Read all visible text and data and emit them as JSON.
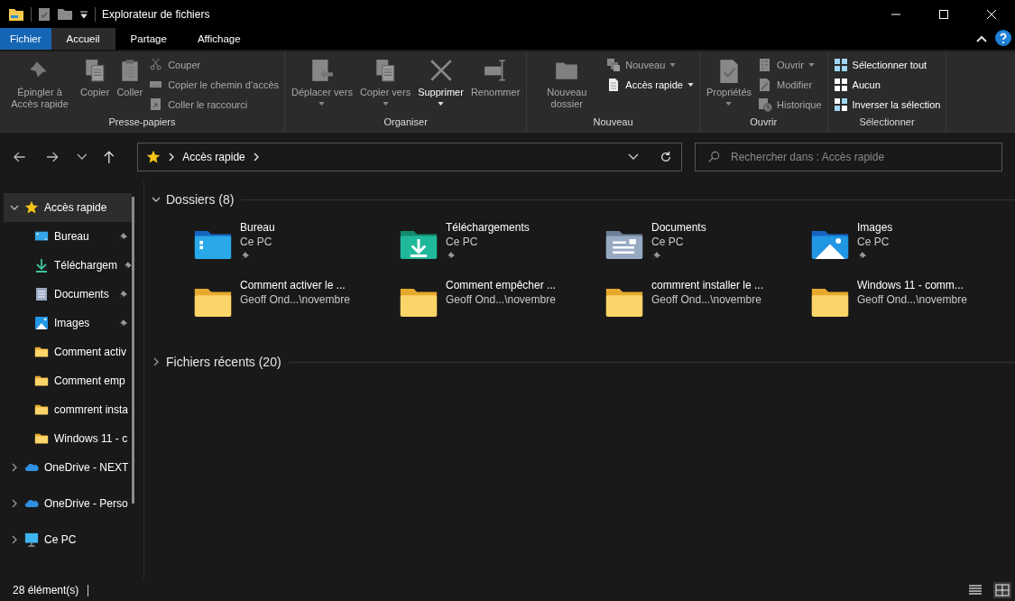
{
  "window": {
    "title": "Explorateur de fichiers"
  },
  "tabs": [
    {
      "label": "Fichier",
      "kind": "file",
      "selected": false
    },
    {
      "label": "Accueil",
      "kind": "tab",
      "selected": true
    },
    {
      "label": "Partage",
      "kind": "tab",
      "selected": false
    },
    {
      "label": "Affichage",
      "kind": "tab",
      "selected": false
    }
  ],
  "ribbon": {
    "groups": [
      {
        "label": "Presse-papiers",
        "items": [
          {
            "kind": "large",
            "label": "Épingler à Accès rapide",
            "disabled": true,
            "dropdown": false
          },
          {
            "kind": "large",
            "label": "Copier",
            "disabled": true,
            "dropdown": false
          },
          {
            "kind": "large",
            "label": "Coller",
            "disabled": true,
            "dropdown": false
          },
          {
            "kind": "stack",
            "items": [
              {
                "label": "Couper",
                "disabled": true,
                "dropdown": false
              },
              {
                "label": "Copier le chemin d’accès",
                "disabled": true,
                "dropdown": false
              },
              {
                "label": "Coller le raccourci",
                "disabled": true,
                "dropdown": false
              }
            ]
          }
        ]
      },
      {
        "label": "Organiser",
        "items": [
          {
            "kind": "large",
            "label": "Déplacer vers",
            "disabled": true,
            "dropdown": true
          },
          {
            "kind": "large",
            "label": "Copier vers",
            "disabled": true,
            "dropdown": true
          },
          {
            "kind": "large",
            "label": "Supprimer",
            "disabled": false,
            "dropdown": true
          },
          {
            "kind": "large",
            "label": "Renommer",
            "disabled": true,
            "dropdown": false
          }
        ]
      },
      {
        "label": "Nouveau",
        "items": [
          {
            "kind": "large",
            "label": "Nouveau dossier",
            "disabled": true,
            "dropdown": false
          },
          {
            "kind": "stack",
            "items": [
              {
                "label": "Nouveau",
                "disabled": true,
                "dropdown": true
              },
              {
                "label": "Accès rapide",
                "disabled": false,
                "dropdown": true
              }
            ]
          }
        ]
      },
      {
        "label": "Ouvrir",
        "items": [
          {
            "kind": "large",
            "label": "Propriétés",
            "disabled": true,
            "dropdown": true
          },
          {
            "kind": "stack",
            "items": [
              {
                "label": "Ouvrir",
                "disabled": true,
                "dropdown": true
              },
              {
                "label": "Modifier",
                "disabled": true,
                "dropdown": false
              },
              {
                "label": "Historique",
                "disabled": true,
                "dropdown": false
              }
            ]
          }
        ]
      },
      {
        "label": "Sélectionner",
        "items": [
          {
            "kind": "stack",
            "items": [
              {
                "label": "Sélectionner tout",
                "disabled": false,
                "dropdown": false
              },
              {
                "label": "Aucun",
                "disabled": false,
                "dropdown": false
              },
              {
                "label": "Inverser la sélection",
                "disabled": false,
                "dropdown": false
              }
            ]
          }
        ]
      }
    ]
  },
  "address": {
    "crumb": "Accès rapide"
  },
  "search": {
    "placeholder": "Rechercher dans : Accès rapide"
  },
  "sidebar": {
    "items": [
      {
        "label": "Accès rapide",
        "kind": "quick",
        "expanded": true,
        "selected": true,
        "children": [
          {
            "label": "Bureau",
            "kind": "desktop",
            "pinned": true,
            "selected": false
          },
          {
            "label": "Téléchargem",
            "kind": "downloads",
            "pinned": true,
            "selected": false
          },
          {
            "label": "Documents",
            "kind": "documents",
            "pinned": true,
            "selected": false
          },
          {
            "label": "Images",
            "kind": "pictures",
            "pinned": true,
            "selected": false
          },
          {
            "label": "Comment activ",
            "kind": "folder",
            "pinned": false,
            "selected": false
          },
          {
            "label": "Comment emp",
            "kind": "folder",
            "pinned": false,
            "selected": false
          },
          {
            "label": "commrent insta",
            "kind": "folder",
            "pinned": false,
            "selected": false
          },
          {
            "label": "Windows 11 - c",
            "kind": "folder",
            "pinned": false,
            "selected": false
          }
        ]
      },
      {
        "label": "OneDrive - NEXT",
        "kind": "cloud",
        "expanded": false,
        "selected": false
      },
      {
        "label": "OneDrive - Perso",
        "kind": "cloud",
        "expanded": false,
        "selected": false
      },
      {
        "label": "Ce PC",
        "kind": "pc",
        "expanded": false,
        "selected": false
      }
    ]
  },
  "sections": [
    {
      "title": "Dossiers (8)",
      "expanded": true,
      "items": [
        {
          "name": "Bureau",
          "location": "Ce PC",
          "kind": "desktop",
          "pinned": true
        },
        {
          "name": "Téléchargements",
          "location": "Ce PC",
          "kind": "downloads",
          "pinned": true
        },
        {
          "name": "Documents",
          "location": "Ce PC",
          "kind": "documents",
          "pinned": true
        },
        {
          "name": "Images",
          "location": "Ce PC",
          "kind": "pictures",
          "pinned": true
        },
        {
          "name": "Comment activer le ...",
          "location": "Geoff Ond...\\novembre",
          "kind": "folder",
          "pinned": false
        },
        {
          "name": "Comment empêcher ...",
          "location": "Geoff Ond...\\novembre",
          "kind": "folder",
          "pinned": false
        },
        {
          "name": "commrent installer le ...",
          "location": "Geoff Ond...\\novembre",
          "kind": "folder",
          "pinned": false
        },
        {
          "name": "Windows 11 - comm...",
          "location": "Geoff Ond...\\novembre",
          "kind": "folder",
          "pinned": false
        }
      ]
    },
    {
      "title": "Fichiers récents (20)",
      "expanded": false
    }
  ],
  "status_bar": {
    "count": "28 élément(s)"
  }
}
